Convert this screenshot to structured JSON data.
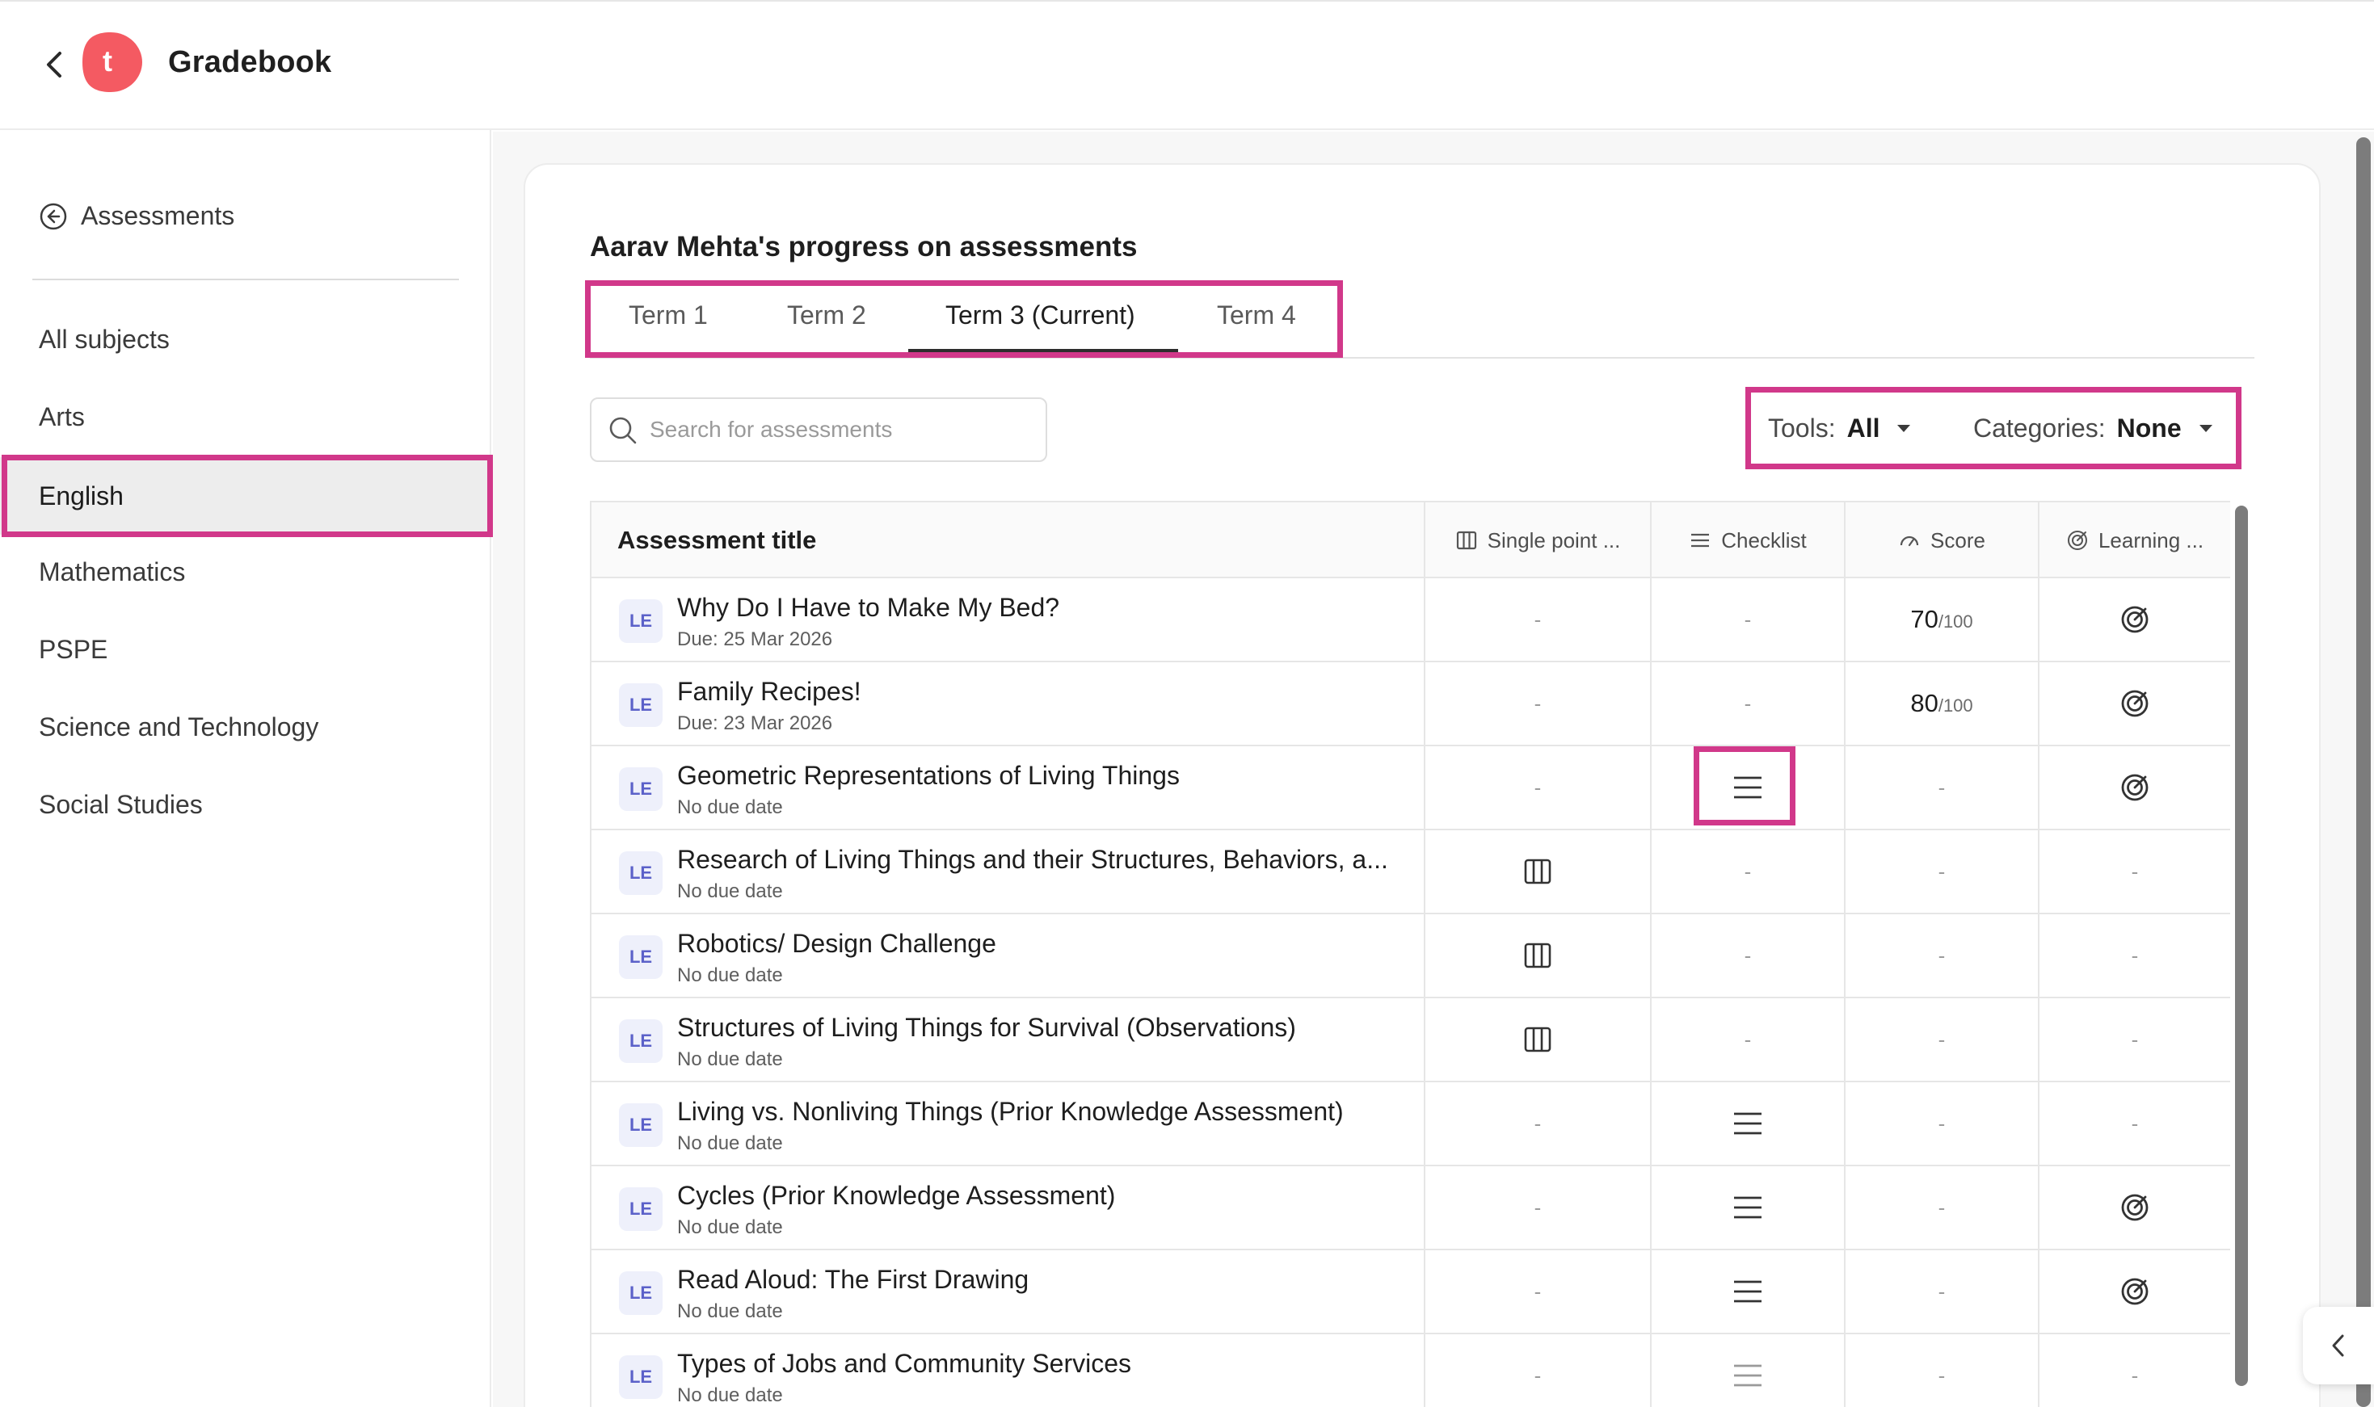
{
  "app": {
    "title": "Gradebook",
    "logo_letter": "t",
    "brand_color": "#f45a62",
    "highlight_color": "#d1388a"
  },
  "sidebar": {
    "back_label": "Assessments",
    "items": [
      {
        "label": "All subjects",
        "active": false
      },
      {
        "label": "Arts",
        "active": false
      },
      {
        "label": "English",
        "active": true
      },
      {
        "label": "Mathematics",
        "active": false
      },
      {
        "label": "PSPE",
        "active": false
      },
      {
        "label": "Science and Technology",
        "active": false
      },
      {
        "label": "Social Studies",
        "active": false
      }
    ]
  },
  "main": {
    "title": "Aarav Mehta's progress on assessments",
    "tabs": [
      {
        "label": "Term 1",
        "active": false
      },
      {
        "label": "Term 2",
        "active": false
      },
      {
        "label": "Term 3 (Current)",
        "active": true
      },
      {
        "label": "Term 4",
        "active": false
      }
    ],
    "search": {
      "placeholder": "Search for assessments"
    },
    "filters": {
      "tools_label": "Tools:",
      "tools_value": "All",
      "categories_label": "Categories:",
      "categories_value": "None"
    }
  },
  "table": {
    "columns": {
      "title": "Assessment title",
      "single_point": "Single point ...",
      "checklist": "Checklist",
      "score": "Score",
      "learning": "Learning ..."
    },
    "rows": [
      {
        "badge": "LE",
        "title": "Why Do I Have to Make My Bed?",
        "due": "Due: 25 Mar 2026",
        "single_point": "-",
        "checklist": "-",
        "score": "70",
        "score_max": "/100",
        "learning": "target"
      },
      {
        "badge": "LE",
        "title": "Family Recipes!",
        "due": "Due: 23 Mar 2026",
        "single_point": "-",
        "checklist": "-",
        "score": "80",
        "score_max": "/100",
        "learning": "target"
      },
      {
        "badge": "LE",
        "title": "Geometric Representations of Living Things",
        "due": "No due date",
        "single_point": "-",
        "checklist": "list",
        "score": "-",
        "learning": "target"
      },
      {
        "badge": "LE",
        "title": "Research of Living Things and their Structures, Behaviors, a...",
        "due": "No due date",
        "single_point": "grid",
        "checklist": "-",
        "score": "-",
        "learning": "-"
      },
      {
        "badge": "LE",
        "title": "Robotics/ Design Challenge",
        "due": "No due date",
        "single_point": "grid",
        "checklist": "-",
        "score": "-",
        "learning": "-"
      },
      {
        "badge": "LE",
        "title": "Structures of Living Things for Survival (Observations)",
        "due": "No due date",
        "single_point": "grid",
        "checklist": "-",
        "score": "-",
        "learning": "-"
      },
      {
        "badge": "LE",
        "title": "Living vs. Nonliving Things (Prior Knowledge Assessment)",
        "due": "No due date",
        "single_point": "-",
        "checklist": "list",
        "score": "-",
        "learning": "-"
      },
      {
        "badge": "LE",
        "title": "Cycles (Prior Knowledge Assessment)",
        "due": "No due date",
        "single_point": "-",
        "checklist": "list",
        "score": "-",
        "learning": "target"
      },
      {
        "badge": "LE",
        "title": "Read Aloud: The First Drawing",
        "due": "No due date",
        "single_point": "-",
        "checklist": "list",
        "score": "-",
        "learning": "target"
      },
      {
        "badge": "LE",
        "title": "Types of Jobs and Community Services",
        "due": "No due date",
        "single_point": "-",
        "checklist": "list-faded",
        "score": "-",
        "learning": "-"
      }
    ]
  }
}
